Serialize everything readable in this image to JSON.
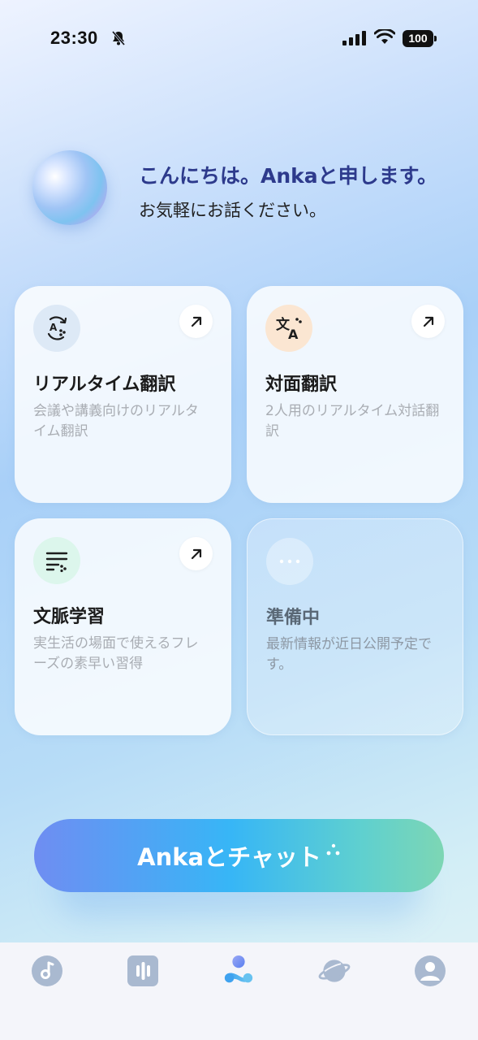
{
  "status": {
    "time": "23:30",
    "battery": "100",
    "icons": [
      "bell-slash-icon",
      "signal-icon",
      "wifi-icon",
      "battery-icon"
    ]
  },
  "greeting": {
    "title": "こんにちは。Ankaと申します。",
    "subtitle": "お気軽にお話ください。"
  },
  "cards": [
    {
      "title": "リアルタイム翻訳",
      "description": "会議や講義向けのリアルタイム翻訳",
      "icon": "translate-sync-icon",
      "arrow": "arrow-up-right-icon"
    },
    {
      "title": "対面翻訳",
      "description": "2人用のリアルタイム対話翻訳",
      "icon": "language-icon",
      "arrow": "arrow-up-right-icon"
    },
    {
      "title": "文脈学習",
      "description": "実生活の場面で使えるフレーズの素早い習得",
      "icon": "text-lines-icon",
      "arrow": "arrow-up-right-icon"
    },
    {
      "title": "準備中",
      "description": "最新情報が近日公開予定です。",
      "icon": "more-dots-icon"
    }
  ],
  "chat_button": {
    "label": "Ankaとチャット"
  },
  "tabbar": {
    "items": [
      "music-note-icon",
      "audio-bars-icon",
      "anka-home-icon",
      "planet-icon",
      "profile-icon"
    ]
  },
  "colors": {
    "greeting_title": "#2d3a8c",
    "accent_gradient_start": "#6f8df2",
    "accent_gradient_mid": "#37b6f6",
    "accent_gradient_end": "#7dd6b4"
  }
}
